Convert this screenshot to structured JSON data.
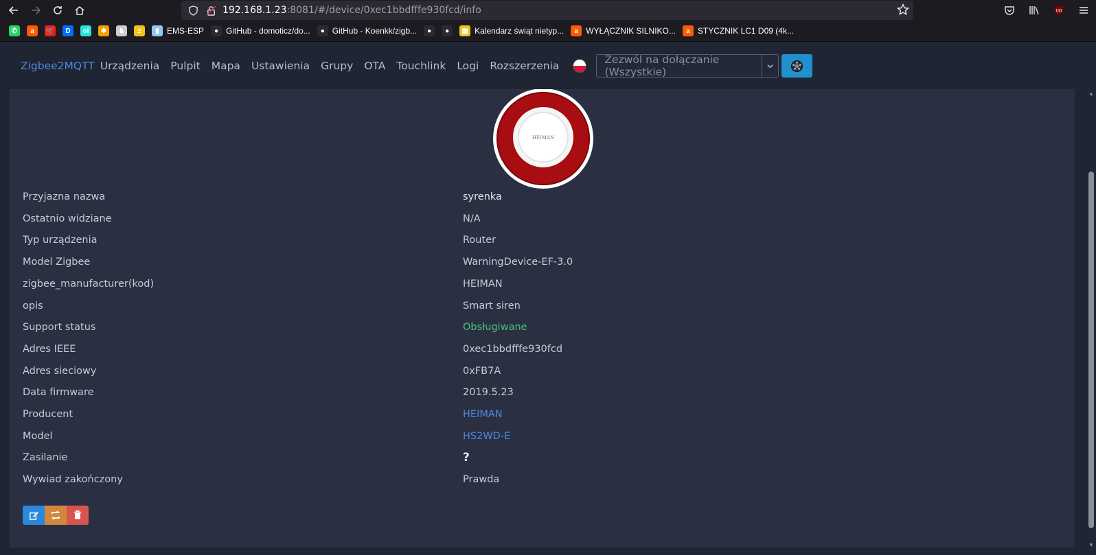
{
  "browser": {
    "url_host": "192.168.1.23",
    "url_rest": ":8081/#/device/0xec1bbdfffe930fcd/info"
  },
  "bookmarks": [
    {
      "label": "",
      "color": "#25d366",
      "glyph": "✆"
    },
    {
      "label": "",
      "color": "#ff5a00",
      "glyph": "a"
    },
    {
      "label": "",
      "color": "#e2231a",
      "glyph": "🛒"
    },
    {
      "label": "",
      "color": "#0070ff",
      "glyph": "D"
    },
    {
      "label": "",
      "color": "#23e5db",
      "glyph": "ol"
    },
    {
      "label": "",
      "color": "#f4a100",
      "glyph": "✱"
    },
    {
      "label": "",
      "color": "#cccccc",
      "glyph": "♞"
    },
    {
      "label": "",
      "color": "#f0c419",
      "glyph": "±"
    },
    {
      "label": "EMS-ESP",
      "color": "#8fc9f0",
      "glyph": "▮"
    },
    {
      "label": "GitHub - domoticz/do...",
      "color": "#2b2a33",
      "glyph": "●"
    },
    {
      "label": "GitHub - Koenkk/zigb...",
      "color": "#2b2a33",
      "glyph": "●"
    },
    {
      "label": "",
      "color": "#2b2a33",
      "glyph": "●"
    },
    {
      "label": "",
      "color": "#2b2a33",
      "glyph": "●"
    },
    {
      "label": "Kalendarz świąt nietyp...",
      "color": "#f0c419",
      "glyph": "▦"
    },
    {
      "label": "WYŁĄCZNIK SILNIKO...",
      "color": "#ff5a00",
      "glyph": "a"
    },
    {
      "label": "STYCZNIK LC1 D09 (4k...",
      "color": "#ff5a00",
      "glyph": "a"
    }
  ],
  "nav": {
    "brand": "Zigbee2MQTT",
    "links": [
      "Urządzenia",
      "Pulpit",
      "Mapa",
      "Ustawienia",
      "Grupy",
      "OTA",
      "Touchlink",
      "Logi",
      "Rozszerzenia"
    ],
    "permit_placeholder": "Zezwól na dołączanie (Wszystkie)"
  },
  "device": {
    "image_text": "HEIMAN",
    "rows": [
      {
        "key": "Przyjazna nazwa",
        "value": "syrenka",
        "style": "bold"
      },
      {
        "key": "Ostatnio widziane",
        "value": "N/A",
        "style": ""
      },
      {
        "key": "Typ urządzenia",
        "value": "Router",
        "style": ""
      },
      {
        "key": "Model Zigbee",
        "value": "WarningDevice-EF-3.0",
        "style": ""
      },
      {
        "key": "zigbee_manufacturer(kod)",
        "value": "HEIMAN",
        "style": ""
      },
      {
        "key": "opis",
        "value": "Smart siren",
        "style": ""
      },
      {
        "key": "Support status",
        "value": "Obsługiwane",
        "style": "green"
      },
      {
        "key": "Adres IEEE",
        "value": "0xec1bbdfffe930fcd",
        "style": ""
      },
      {
        "key": "Adres sieciowy",
        "value": "0xFB7A",
        "style": ""
      },
      {
        "key": "Data firmware",
        "value": "2019.5.23",
        "style": ""
      },
      {
        "key": "Producent",
        "value": "HEIMAN",
        "style": "link"
      },
      {
        "key": "Model",
        "value": "HS2WD-E",
        "style": "link"
      },
      {
        "key": "Zasilanie",
        "value": "?",
        "style": "bold"
      },
      {
        "key": "Wywiad zakończony",
        "value": "Prawda",
        "style": ""
      }
    ]
  },
  "colors": {
    "accent": "#4a88e0",
    "supported": "#45c576",
    "edit": "#2a88dd",
    "reconfigure": "#d1883d",
    "remove": "#d9534f"
  }
}
